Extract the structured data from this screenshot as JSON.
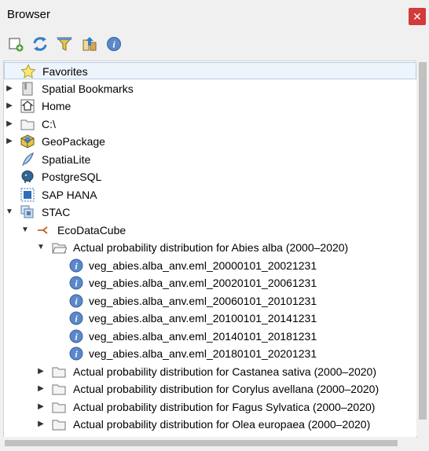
{
  "window": {
    "title": "Browser",
    "close_glyph": "✕"
  },
  "toolbar": {
    "buttons": [
      {
        "name": "add-layer-icon"
      },
      {
        "name": "refresh-icon"
      },
      {
        "name": "filter-icon"
      },
      {
        "name": "collapse-all-icon"
      },
      {
        "name": "info-icon"
      }
    ]
  },
  "tree": {
    "items": [
      {
        "label": "Favorites",
        "icon": "star-icon"
      },
      {
        "label": "Spatial Bookmarks",
        "icon": "bookmark-icon"
      },
      {
        "label": "Home",
        "icon": "home-icon"
      },
      {
        "label": "C:\\",
        "icon": "folder-icon"
      },
      {
        "label": "GeoPackage",
        "icon": "geopackage-icon"
      },
      {
        "label": "SpatiaLite",
        "icon": "spatialite-icon"
      },
      {
        "label": "PostgreSQL",
        "icon": "postgresql-icon"
      },
      {
        "label": "SAP HANA",
        "icon": "sap-hana-icon"
      },
      {
        "label": "STAC",
        "icon": "stac-icon"
      },
      {
        "label": "EcoDataCube",
        "icon": "connection-icon"
      },
      {
        "label": "Actual probability distribution for Abies alba (2000–2020)",
        "icon": "folder-open-icon"
      },
      {
        "label": "veg_abies.alba_anv.eml_20000101_20021231",
        "icon": "info-icon"
      },
      {
        "label": "veg_abies.alba_anv.eml_20020101_20061231",
        "icon": "info-icon"
      },
      {
        "label": "veg_abies.alba_anv.eml_20060101_20101231",
        "icon": "info-icon"
      },
      {
        "label": "veg_abies.alba_anv.eml_20100101_20141231",
        "icon": "info-icon"
      },
      {
        "label": "veg_abies.alba_anv.eml_20140101_20181231",
        "icon": "info-icon"
      },
      {
        "label": "veg_abies.alba_anv.eml_20180101_20201231",
        "icon": "info-icon"
      },
      {
        "label": "Actual probability distribution for Castanea sativa (2000–2020)",
        "icon": "folder-icon"
      },
      {
        "label": "Actual probability distribution for Corylus avellana (2000–2020)",
        "icon": "folder-icon"
      },
      {
        "label": "Actual probability distribution for Fagus Sylvatica (2000–2020)",
        "icon": "folder-icon"
      },
      {
        "label": "Actual probability distribution for Olea europaea (2000–2020)",
        "icon": "folder-icon"
      }
    ]
  }
}
